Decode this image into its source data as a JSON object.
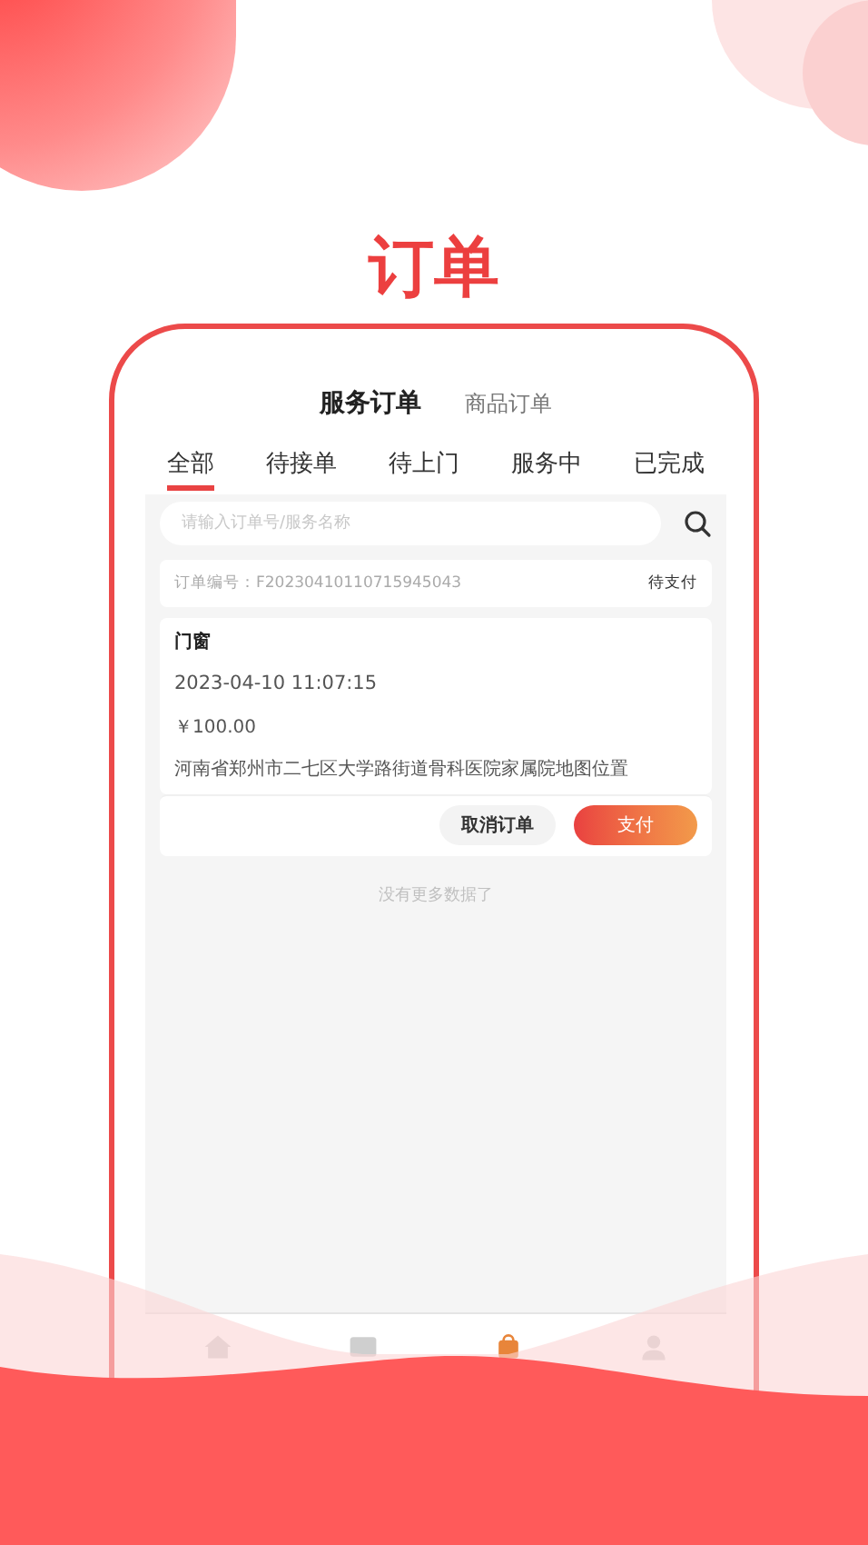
{
  "heading": "订单",
  "order_types": [
    {
      "label": "服务订单",
      "selected": true
    },
    {
      "label": "商品订单",
      "selected": false
    }
  ],
  "tabs": [
    {
      "label": "全部",
      "selected": true
    },
    {
      "label": "待接单",
      "selected": false
    },
    {
      "label": "待上门",
      "selected": false
    },
    {
      "label": "服务中",
      "selected": false
    },
    {
      "label": "已完成",
      "selected": false
    }
  ],
  "search": {
    "placeholder": "请输入订单号/服务名称"
  },
  "orders": [
    {
      "number": "订单编号：F20230410110715945043",
      "status": "待支付",
      "service": "门窗",
      "time": "2023-04-10 11:07:15",
      "price": "￥100.00",
      "address": "河南省郑州市二七区大学路街道骨科医院家属院地图位置",
      "actions": [
        {
          "label": "取消订单",
          "kind": "secondary"
        },
        {
          "label": "支付",
          "kind": "primary"
        }
      ]
    }
  ],
  "end_note": "没有更多数据了",
  "bottom_nav": [
    {
      "kind": "home",
      "selected": false
    },
    {
      "kind": "message",
      "selected": false
    },
    {
      "kind": "orders",
      "selected": true
    },
    {
      "kind": "profile",
      "selected": false
    }
  ]
}
